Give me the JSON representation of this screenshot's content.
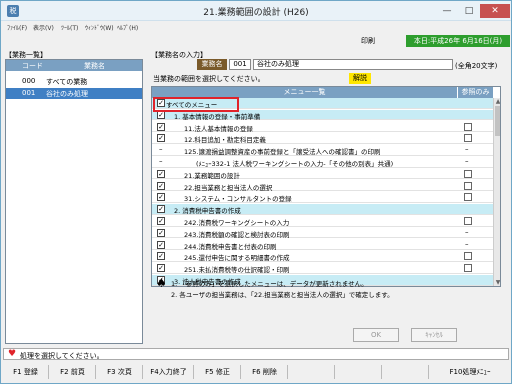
{
  "window": {
    "title": "21.業務範囲の設計 (H26)",
    "minimize": "—",
    "maximize": "□",
    "close": "✕"
  },
  "menu": {
    "items": [
      "ﾌｧｲﾙ(F)",
      "表示(V)",
      "ﾂｰﾙ(T)",
      "ｳｨﾝﾄﾞｳ(W)",
      "ﾍﾙﾌﾟ(H)"
    ]
  },
  "toolbar": {
    "print_label": "印刷",
    "date": "本日:平成26年 6月16日(月)"
  },
  "left_panel": {
    "section_label": "【業務一覧】",
    "col_code": "コード",
    "col_name": "業務名",
    "rows": [
      {
        "code": "000",
        "name": "すべての業務"
      },
      {
        "code": "001",
        "name": "谷社のみ処理"
      }
    ]
  },
  "input": {
    "section_label": "【業務名の入力】",
    "code_label": "業務名",
    "code_value": "001",
    "name_value": "谷社のみ処理",
    "char_limit": "(全角20文字)"
  },
  "instruction": "当業務の範囲を選択してください。",
  "help_label": "解説",
  "table": {
    "col_menu": "メニュー一覧",
    "col_ref": "参照のみ",
    "rows": [
      {
        "mark": "✓",
        "text": "すべてのメニュー",
        "ref": "",
        "hl": true,
        "indent": 0
      },
      {
        "mark": "✓",
        "text": "1. 基本情報の登録・事前準備",
        "ref": "",
        "hl": true,
        "indent": 1
      },
      {
        "mark": "✓",
        "text": "11.法人基本情報の登録",
        "ref": "box",
        "hl": false,
        "indent": 2
      },
      {
        "mark": "✓",
        "text": "12.科目追加・勘定科目定義",
        "ref": "box",
        "hl": false,
        "indent": 2
      },
      {
        "mark": "–",
        "text": "125.譲渡損益調整資産の事前登録と「譲受法人への確認書」の印刷",
        "ref": "–",
        "hl": false,
        "indent": 2
      },
      {
        "mark": "–",
        "text": "(ﾒﾆｭｰ332-1 法人税ワーキングシートの入力-「その他の別表」共通)",
        "ref": "–",
        "hl": false,
        "indent": 3
      },
      {
        "mark": "✓",
        "text": "21.業務範囲の設計",
        "ref": "box",
        "hl": false,
        "indent": 2
      },
      {
        "mark": "✓",
        "text": "22.担当業務と担当法人の選択",
        "ref": "box",
        "hl": false,
        "indent": 2
      },
      {
        "mark": "✓",
        "text": "31.システム・コンサルタントの登録",
        "ref": "box",
        "hl": false,
        "indent": 2
      },
      {
        "mark": "✓",
        "text": "2. 消費税申告書の作成",
        "ref": "",
        "hl": true,
        "indent": 1
      },
      {
        "mark": "✓",
        "text": "242.消費税ワーキングシートの入力",
        "ref": "box",
        "hl": false,
        "indent": 2
      },
      {
        "mark": "✓",
        "text": "243.消費税額の確認と検討表の印刷",
        "ref": "–",
        "hl": false,
        "indent": 2
      },
      {
        "mark": "✓",
        "text": "244.消費税申告書と付表の印刷",
        "ref": "–",
        "hl": false,
        "indent": 2
      },
      {
        "mark": "✓",
        "text": "245.還付申告に関する明細書の作成",
        "ref": "box",
        "hl": false,
        "indent": 2
      },
      {
        "mark": "✓",
        "text": "251.未払消費税等の仕訳確認・印刷",
        "ref": "box",
        "hl": false,
        "indent": 2
      },
      {
        "mark": "✓",
        "text": "3. 法人税申告書の作成",
        "ref": "",
        "hl": true,
        "indent": 1
      }
    ]
  },
  "notes": [
    "1. 「参照のみ」を選択したメニューは、データが更新されません。",
    "2. 各ユーザの担当業務は、「22.担当業務と担当法人の選択」で確定します。"
  ],
  "buttons": {
    "ok": "OK",
    "cancel": "ｷｬﾝｾﾙ"
  },
  "status_text": "処理を選択してください。",
  "fkeys": [
    "F1 登録",
    "F2 前頁",
    "F3 次頁",
    "F4入力終了",
    "F5 修正",
    "F6 削除",
    "",
    "",
    "",
    "F10処理ﾒﾆｭｰ"
  ],
  "colors": {
    "header_blue": "#7aa0c2",
    "selected_blue": "#3f7fc4",
    "highlight_cyan": "#c7ecf5",
    "date_green": "#2e9e2e",
    "help_yellow": "#ffe600",
    "annotation_red": "#e0232a"
  }
}
